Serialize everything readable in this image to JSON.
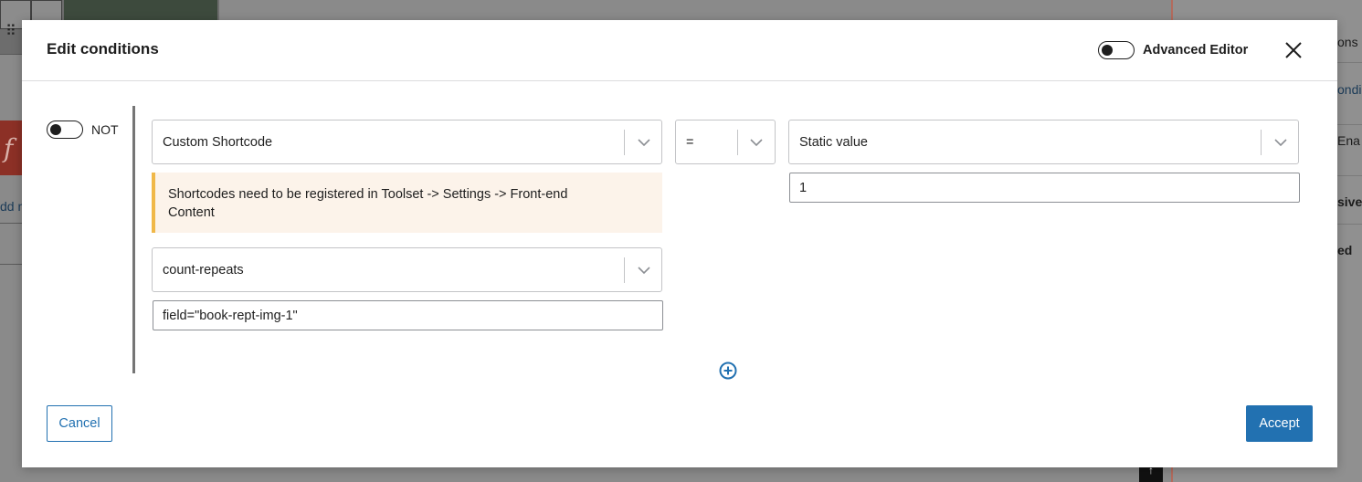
{
  "background": {
    "left_fragment_1": "dd n",
    "right_fragments": [
      "ons",
      "ondi",
      "Ena",
      "sive",
      "ed"
    ]
  },
  "modal": {
    "title": "Edit conditions",
    "advanced_editor_label": "Advanced Editor",
    "advanced_editor_on": false,
    "close_icon": "close-icon"
  },
  "condition": {
    "not_label": "NOT",
    "not_on": false,
    "source_select": "Custom Shortcode",
    "notice": "Shortcodes need to be registered in Toolset -> Settings -> Front-end Content",
    "shortcode_select": "count-repeats",
    "shortcode_attributes": "field=\"book-rept-img-1\"",
    "operator_select": "=",
    "value_type_select": "Static value",
    "value_input": "1"
  },
  "actions": {
    "add_condition_icon": "plus-circle-icon",
    "cancel_label": "Cancel",
    "accept_label": "Accept"
  },
  "colors": {
    "primary": "#2271b1",
    "notice_bg": "#fcf3ea",
    "notice_border": "#f0b849"
  }
}
